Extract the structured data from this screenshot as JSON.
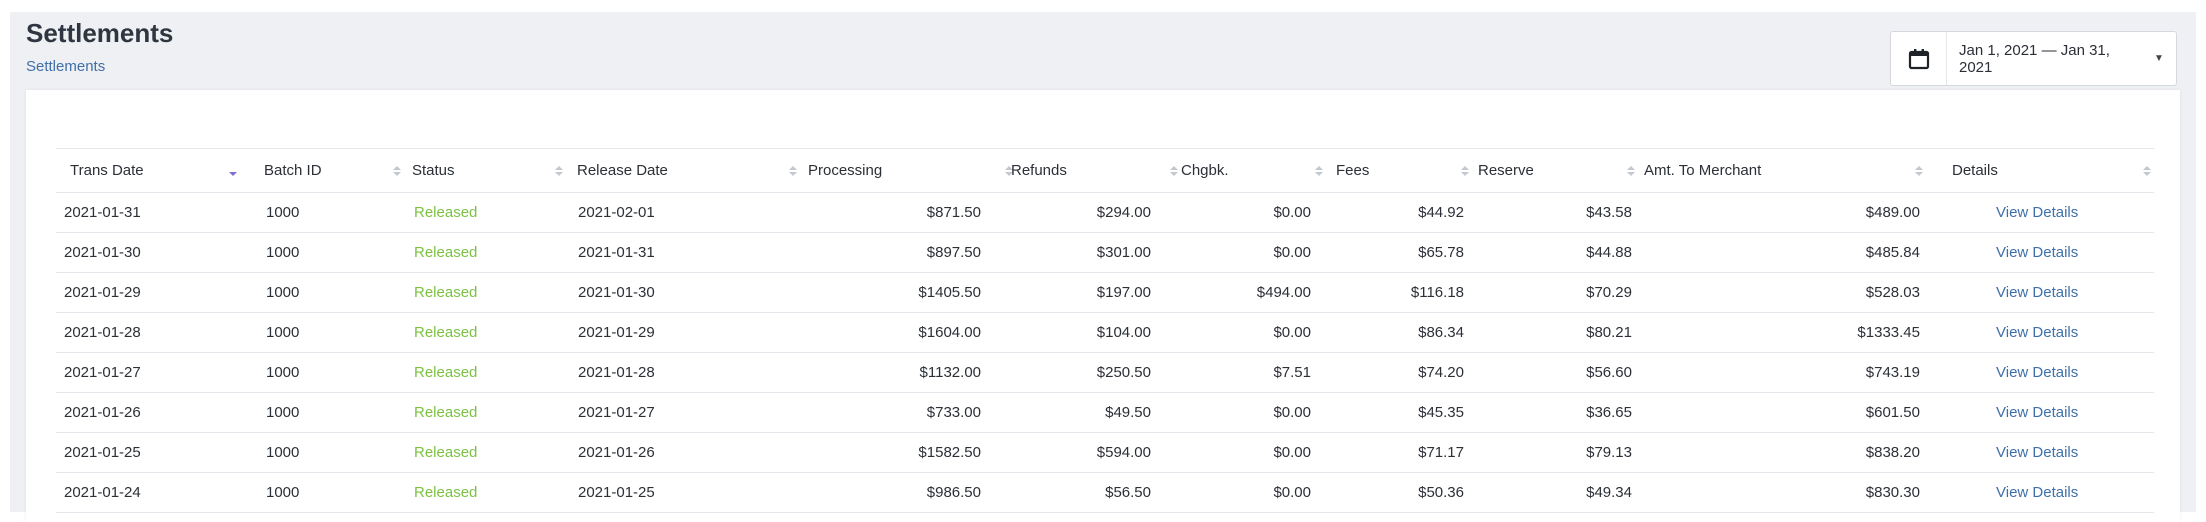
{
  "header": {
    "title": "Settlements",
    "breadcrumb": "Settlements"
  },
  "date_range": {
    "label": "Jan 1, 2021 — Jan 31, 2021",
    "icon": "calendar-icon",
    "caret_icon": "caret-down-icon"
  },
  "colors": {
    "status_released": "#7cc242",
    "link": "#3f6fa8",
    "sort_active": "#7b6fd6",
    "sort_inactive": "#c3c8cf"
  },
  "table": {
    "columns": [
      {
        "key": "trans_date",
        "label": "Trans Date"
      },
      {
        "key": "batch_id",
        "label": "Batch ID"
      },
      {
        "key": "status",
        "label": "Status"
      },
      {
        "key": "release_date",
        "label": "Release Date"
      },
      {
        "key": "processing",
        "label": "Processing"
      },
      {
        "key": "refunds",
        "label": "Refunds"
      },
      {
        "key": "chgbk",
        "label": "Chgbk."
      },
      {
        "key": "fees",
        "label": "Fees"
      },
      {
        "key": "reserve",
        "label": "Reserve"
      },
      {
        "key": "amt_to_merchant",
        "label": "Amt. To Merchant"
      },
      {
        "key": "details",
        "label": "Details"
      }
    ],
    "sort_column": "trans_date",
    "sort_direction": "descending",
    "rows": [
      {
        "trans_date": "2021-01-31",
        "batch_id": "1000",
        "status": "Released",
        "release_date": "2021-02-01",
        "processing": "$871.50",
        "refunds": "$294.00",
        "chgbk": "$0.00",
        "fees": "$44.92",
        "reserve": "$43.58",
        "amt_to_merchant": "$489.00",
        "details": "View Details"
      },
      {
        "trans_date": "2021-01-30",
        "batch_id": "1000",
        "status": "Released",
        "release_date": "2021-01-31",
        "processing": "$897.50",
        "refunds": "$301.00",
        "chgbk": "$0.00",
        "fees": "$65.78",
        "reserve": "$44.88",
        "amt_to_merchant": "$485.84",
        "details": "View Details"
      },
      {
        "trans_date": "2021-01-29",
        "batch_id": "1000",
        "status": "Released",
        "release_date": "2021-01-30",
        "processing": "$1405.50",
        "refunds": "$197.00",
        "chgbk": "$494.00",
        "fees": "$116.18",
        "reserve": "$70.29",
        "amt_to_merchant": "$528.03",
        "details": "View Details"
      },
      {
        "trans_date": "2021-01-28",
        "batch_id": "1000",
        "status": "Released",
        "release_date": "2021-01-29",
        "processing": "$1604.00",
        "refunds": "$104.00",
        "chgbk": "$0.00",
        "fees": "$86.34",
        "reserve": "$80.21",
        "amt_to_merchant": "$1333.45",
        "details": "View Details"
      },
      {
        "trans_date": "2021-01-27",
        "batch_id": "1000",
        "status": "Released",
        "release_date": "2021-01-28",
        "processing": "$1132.00",
        "refunds": "$250.50",
        "chgbk": "$7.51",
        "fees": "$74.20",
        "reserve": "$56.60",
        "amt_to_merchant": "$743.19",
        "details": "View Details"
      },
      {
        "trans_date": "2021-01-26",
        "batch_id": "1000",
        "status": "Released",
        "release_date": "2021-01-27",
        "processing": "$733.00",
        "refunds": "$49.50",
        "chgbk": "$0.00",
        "fees": "$45.35",
        "reserve": "$36.65",
        "amt_to_merchant": "$601.50",
        "details": "View Details"
      },
      {
        "trans_date": "2021-01-25",
        "batch_id": "1000",
        "status": "Released",
        "release_date": "2021-01-26",
        "processing": "$1582.50",
        "refunds": "$594.00",
        "chgbk": "$0.00",
        "fees": "$71.17",
        "reserve": "$79.13",
        "amt_to_merchant": "$838.20",
        "details": "View Details"
      },
      {
        "trans_date": "2021-01-24",
        "batch_id": "1000",
        "status": "Released",
        "release_date": "2021-01-25",
        "processing": "$986.50",
        "refunds": "$56.50",
        "chgbk": "$0.00",
        "fees": "$50.36",
        "reserve": "$49.34",
        "amt_to_merchant": "$830.30",
        "details": "View Details"
      }
    ]
  }
}
